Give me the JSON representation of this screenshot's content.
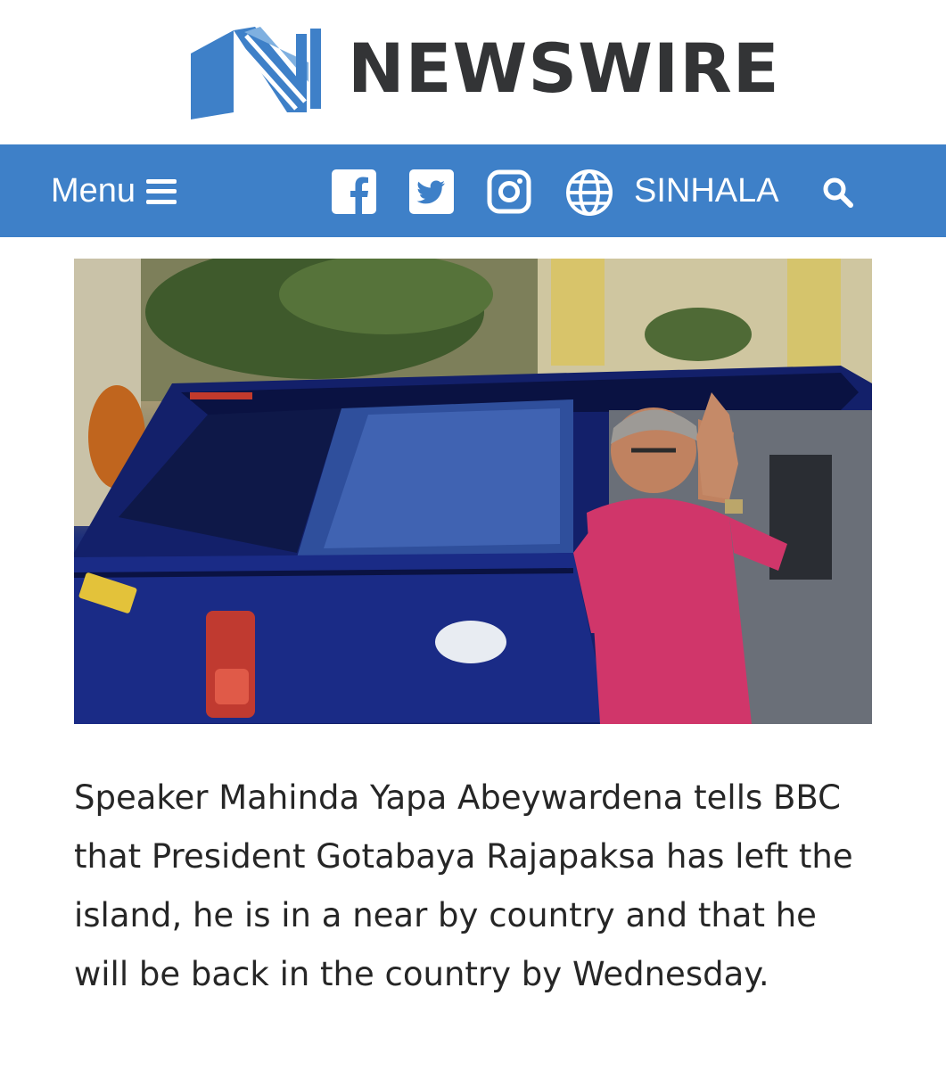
{
  "site": {
    "name": "NEWSWIRE",
    "brand_color": "#3e80c8",
    "logo_icon": "newswire-n-logo"
  },
  "nav": {
    "menu_label": "Menu",
    "menu_icon": "hamburger-icon",
    "social": [
      "facebook-icon",
      "twitter-icon",
      "instagram-icon"
    ],
    "language_label": "SINHALA",
    "language_icon": "globe-icon",
    "search_icon": "search-icon"
  },
  "article": {
    "image_alt": "Man in a red shirt waving beside a dark blue SUV",
    "body": "Speaker Mahinda Yapa Abeywardena tells BBC that President Gotabaya Rajapaksa has left the island, he is in a near by country and that he will be back in the country by Wednesday."
  }
}
